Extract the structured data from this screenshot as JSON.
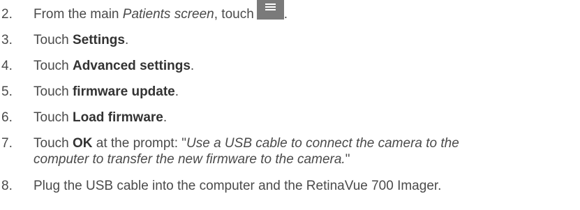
{
  "steps": [
    {
      "number": "2.",
      "prefix": "From the main ",
      "emphasis": "Patients screen",
      "middle": ", touch",
      "icon": "hamburger-menu-icon",
      "suffix": "."
    },
    {
      "number": "3.",
      "prefix": "Touch ",
      "bold": "Settings",
      "suffix": "."
    },
    {
      "number": "4.",
      "prefix": "Touch ",
      "bold": "Advanced settings",
      "suffix": "."
    },
    {
      "number": "5.",
      "prefix": "Touch ",
      "bold": "firmware update",
      "suffix": "."
    },
    {
      "number": "6.",
      "prefix": "Touch ",
      "bold": "Load firmware",
      "suffix": "."
    },
    {
      "number": "7.",
      "prefix": "Touch ",
      "bold": "OK",
      "middle": " at the prompt: \"",
      "quote_line1": "Use a USB cable to connect the camera to the",
      "quote_line2": "computer to transfer the new firmware to the camera.",
      "suffix": "\""
    },
    {
      "number": "8.",
      "text": "Plug the USB cable into the computer and the RetinaVue 700 Imager."
    }
  ]
}
